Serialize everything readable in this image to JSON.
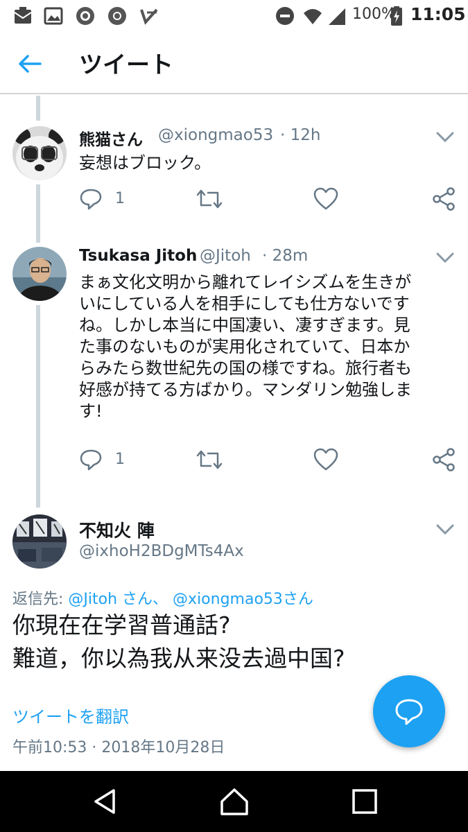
{
  "status_bar": {
    "battery": "100%",
    "time": "11:05",
    "icons_left": [
      "mail-icon",
      "image-icon",
      "app-icon",
      "chrome-icon",
      "check-icon"
    ],
    "icons_right": [
      "dnd-icon",
      "wifi-icon",
      "signal-icon",
      "battery-icon"
    ]
  },
  "header": {
    "title": "ツイート",
    "back_icon": "arrow-left-icon"
  },
  "tweets": [
    {
      "name": "熊猫さん",
      "handle": "@xiongmao53",
      "time": "· 12h",
      "text": "妄想はブロック。",
      "reply_count": "1"
    },
    {
      "name": "Tsukasa Jitoh",
      "handle": "@Jitoh",
      "time": "· 28m",
      "text_lines": [
        "まぁ文化文明から離れてレイシズムを生きが",
        "いにしている人を相手にしても仕方ないです",
        "ね。しかし本当に中国凄い、凄すぎます。見",
        "た事のないものが実用化されていて、日本か",
        "らみたら数世紀先の国の様ですね。旅行者も",
        "好感が持てる方ばかり。マンダリン勉強しま",
        "す!"
      ],
      "reply_count": "1"
    }
  ],
  "main_tweet": {
    "name": "不知火 陣",
    "handle": "@ixhoH2BDgMTs4Ax",
    "reply_prefix": "返信先: ",
    "reply_mention1": "@Jitoh さん、",
    "reply_mention2": "@xiongmao53",
    "reply_suffix": "さん",
    "text_line1": "你現在在学習普通話?",
    "text_line2": "難道，你以為我从来没去過中国?",
    "translate": "ツイートを翻訳",
    "timestamp": "午前10:53 · 2018年10月28日"
  },
  "colors": {
    "accent": "#1da1f2",
    "muted": "#657786",
    "thread_line": "#ccd6dd"
  },
  "nav": [
    "back-triangle-icon",
    "home-icon",
    "recents-icon"
  ]
}
